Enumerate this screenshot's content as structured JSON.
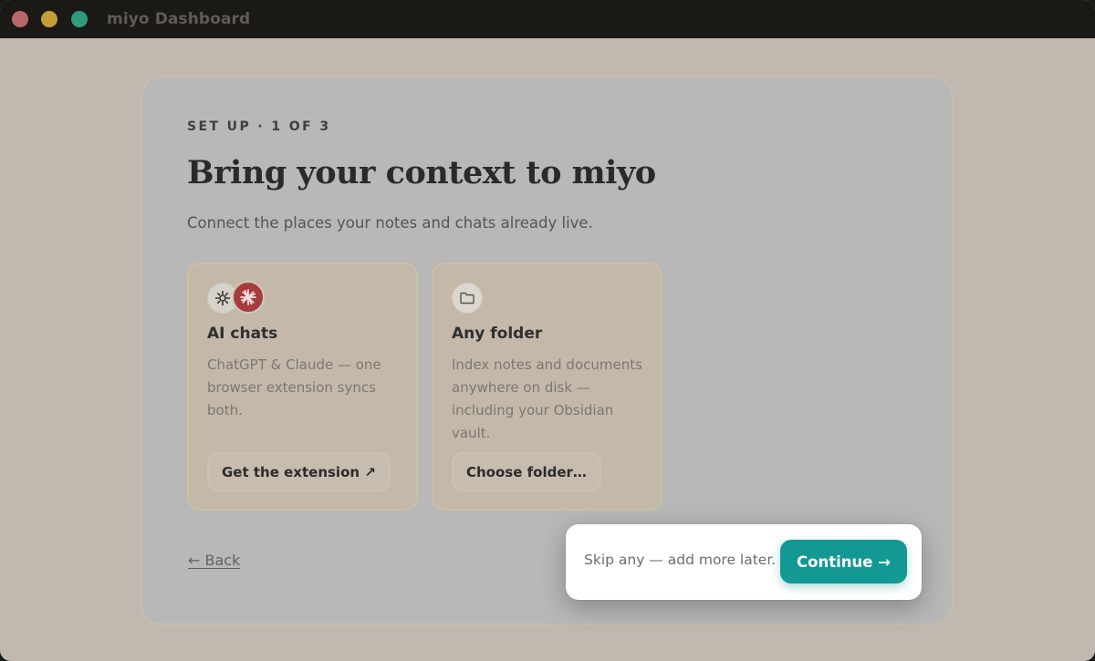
{
  "window": {
    "title": "miyo Dashboard"
  },
  "onboarding": {
    "step_label": "SET UP · 1 OF 3",
    "headline": "Bring your context to miyo",
    "subtitle": "Connect the places your notes and chats already live.",
    "sources": [
      {
        "title": "AI chats",
        "description": "ChatGPT & Claude — one browser extension syncs both.",
        "action_label": "Get the extension ↗",
        "icons": [
          "chatgpt-icon",
          "claude-icon"
        ]
      },
      {
        "title": "Any folder",
        "description": "Index notes and documents anywhere on disk — including your Obsidian vault.",
        "action_label": "Choose folder…",
        "icons": [
          "folder-icon"
        ]
      }
    ],
    "back_label": "← Back",
    "skip_text": "Skip any — add more later.",
    "continue_label": "Continue →"
  },
  "colors": {
    "accent": "#149894",
    "claude": "#a73c3e"
  }
}
